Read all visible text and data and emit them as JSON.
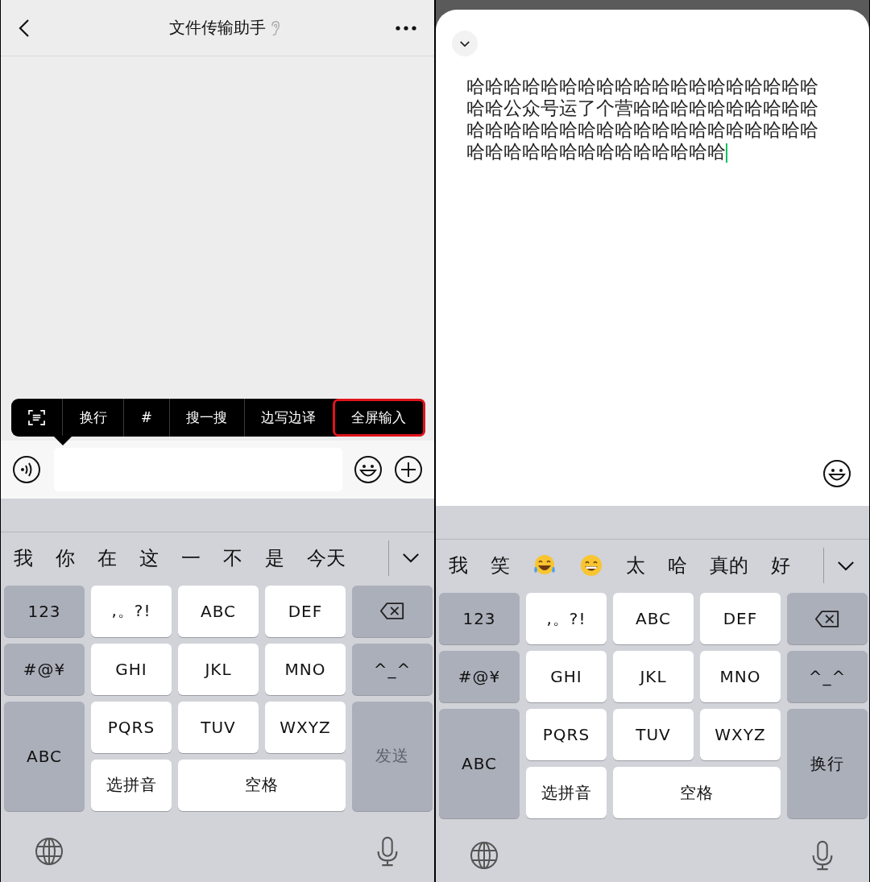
{
  "left_screen": {
    "header": {
      "title": "文件传输助手"
    },
    "context_menu": {
      "items": [
        {
          "kind": "scan",
          "outlined": false
        },
        {
          "kind": "text",
          "label": "换行",
          "outlined": false
        },
        {
          "kind": "text",
          "label": "#",
          "outlined": false
        },
        {
          "kind": "text",
          "label": "搜一搜",
          "outlined": false
        },
        {
          "kind": "text",
          "label": "边写边译",
          "outlined": false
        },
        {
          "kind": "text",
          "label": "全屏输入",
          "outlined": true
        }
      ]
    },
    "keyboard": {
      "candidates": [
        {
          "kind": "word",
          "text": "我"
        },
        {
          "kind": "word",
          "text": "你"
        },
        {
          "kind": "word",
          "text": "在"
        },
        {
          "kind": "word",
          "text": "这"
        },
        {
          "kind": "word",
          "text": "一"
        },
        {
          "kind": "word",
          "text": "不"
        },
        {
          "kind": "word",
          "text": "是"
        },
        {
          "kind": "word",
          "text": "今天"
        }
      ],
      "keys": [
        {
          "kind": "function",
          "label": "123",
          "disabled": false
        },
        {
          "kind": "letter",
          "label": ",。?!",
          "disabled": false
        },
        {
          "kind": "letter",
          "label": "ABC",
          "disabled": false
        },
        {
          "kind": "letter",
          "label": "DEF",
          "disabled": false
        },
        {
          "kind": "backspace",
          "disabled": false
        },
        {
          "kind": "function",
          "label": "#@¥",
          "disabled": false
        },
        {
          "kind": "letter",
          "label": "GHI",
          "disabled": false
        },
        {
          "kind": "letter",
          "label": "JKL",
          "disabled": false
        },
        {
          "kind": "letter",
          "label": "MNO",
          "disabled": false
        },
        {
          "kind": "function",
          "label": "^_^",
          "disabled": false
        },
        {
          "kind": "tall-function",
          "label": "ABC",
          "disabled": false
        },
        {
          "kind": "letter",
          "label": "PQRS",
          "disabled": false
        },
        {
          "kind": "letter",
          "label": "TUV",
          "disabled": false
        },
        {
          "kind": "letter",
          "label": "WXYZ",
          "disabled": false
        },
        {
          "kind": "tall-function",
          "label": "发送",
          "disabled": true
        },
        {
          "kind": "letter",
          "label": "选拼音",
          "disabled": false
        },
        {
          "kind": "space",
          "label": "空格",
          "disabled": false
        }
      ]
    }
  },
  "right_screen": {
    "editor": {
      "text": "哈哈哈哈哈哈哈哈哈哈哈哈哈哈哈哈哈哈哈哈哈公众号运了个营哈哈哈哈哈哈哈哈哈哈哈哈哈哈哈哈哈哈哈哈哈哈哈哈哈哈哈哈哈哈哈哈哈哈哈哈哈哈哈哈哈哈哈"
    },
    "keyboard": {
      "candidates": [
        {
          "kind": "word",
          "text": "我"
        },
        {
          "kind": "word",
          "text": "笑"
        },
        {
          "kind": "tears-of-joy"
        },
        {
          "kind": "grinning"
        },
        {
          "kind": "word",
          "text": "太"
        },
        {
          "kind": "word",
          "text": "哈"
        },
        {
          "kind": "word",
          "text": "真的"
        },
        {
          "kind": "word",
          "text": "好"
        }
      ],
      "keys": [
        {
          "kind": "function",
          "label": "123",
          "disabled": false
        },
        {
          "kind": "letter",
          "label": ",。?!",
          "disabled": false
        },
        {
          "kind": "letter",
          "label": "ABC",
          "disabled": false
        },
        {
          "kind": "letter",
          "label": "DEF",
          "disabled": false
        },
        {
          "kind": "backspace",
          "disabled": false
        },
        {
          "kind": "function",
          "label": "#@¥",
          "disabled": false
        },
        {
          "kind": "letter",
          "label": "GHI",
          "disabled": false
        },
        {
          "kind": "letter",
          "label": "JKL",
          "disabled": false
        },
        {
          "kind": "letter",
          "label": "MNO",
          "disabled": false
        },
        {
          "kind": "function",
          "label": "^_^",
          "disabled": false
        },
        {
          "kind": "tall-function",
          "label": "ABC",
          "disabled": false
        },
        {
          "kind": "letter",
          "label": "PQRS",
          "disabled": false
        },
        {
          "kind": "letter",
          "label": "TUV",
          "disabled": false
        },
        {
          "kind": "letter",
          "label": "WXYZ",
          "disabled": false
        },
        {
          "kind": "tall-function",
          "label": "换行",
          "disabled": false
        },
        {
          "kind": "letter",
          "label": "选拼音",
          "disabled": false
        },
        {
          "kind": "space",
          "label": "空格",
          "disabled": false
        }
      ]
    }
  }
}
